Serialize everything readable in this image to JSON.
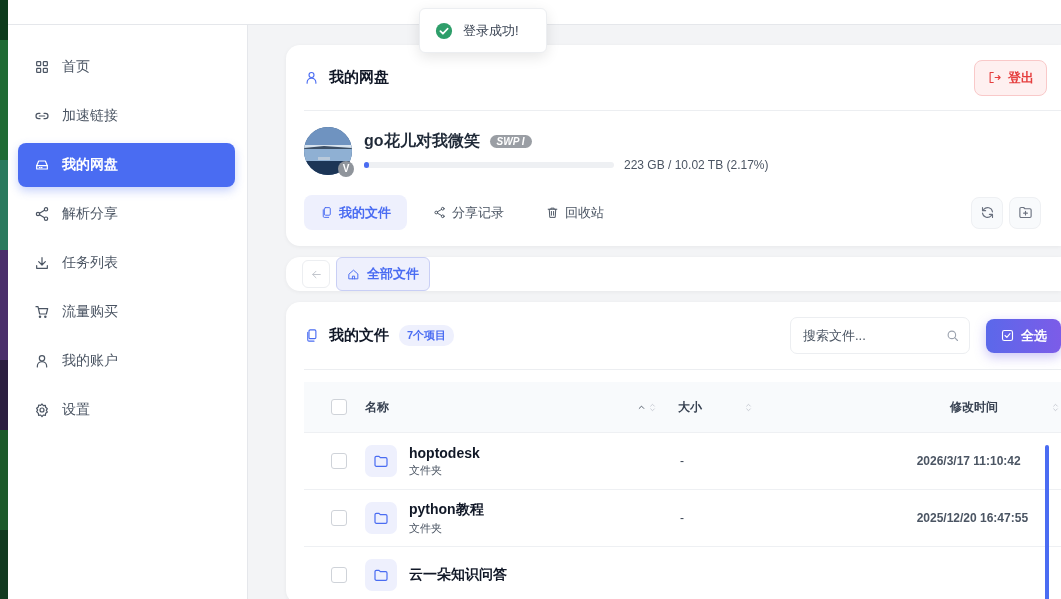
{
  "toast": {
    "text": "登录成功!"
  },
  "sidebar": {
    "items": [
      {
        "label": "首页",
        "selected": false
      },
      {
        "label": "加速链接",
        "selected": false
      },
      {
        "label": "我的网盘",
        "selected": true
      },
      {
        "label": "解析分享",
        "selected": false
      },
      {
        "label": "任务列表",
        "selected": false
      },
      {
        "label": "流量购买",
        "selected": false
      },
      {
        "label": "我的账户",
        "selected": false
      },
      {
        "label": "设置",
        "selected": false
      }
    ]
  },
  "account_card": {
    "title": "我的网盘",
    "logout_button": "登出",
    "user": {
      "name": "go花儿对我微笑",
      "badge": "SWP I",
      "avatar_badge": "V",
      "storage": {
        "level": 0.0217,
        "reading": "223 GB / 10.02 TB (2.17%)"
      }
    },
    "tabs": [
      {
        "label": "我的文件",
        "selected": true
      },
      {
        "label": "分享记录",
        "selected": false
      },
      {
        "label": "回收站",
        "selected": false
      }
    ]
  },
  "breadcrumb": {
    "items": [
      {
        "label": "全部文件",
        "selected": true
      }
    ]
  },
  "files": {
    "title": "我的文件",
    "count": "7个项目",
    "search": {
      "placeholder": "搜索文件..."
    },
    "select_all_button": "全选",
    "header_checked": false,
    "columns": [
      {
        "label": "名称"
      },
      {
        "label": "大小"
      },
      {
        "label": "修改时间"
      }
    ],
    "rows": [
      {
        "name": "hoptodesk",
        "type": "文件夹",
        "size": "-",
        "modified": "2026/3/17 11:10:42",
        "checked": false
      },
      {
        "name": "python教程",
        "type": "文件夹",
        "size": "-",
        "modified": "2025/12/20 16:47:55",
        "checked": false
      },
      {
        "name": "云一朵知识问答",
        "checked": false
      }
    ]
  }
}
